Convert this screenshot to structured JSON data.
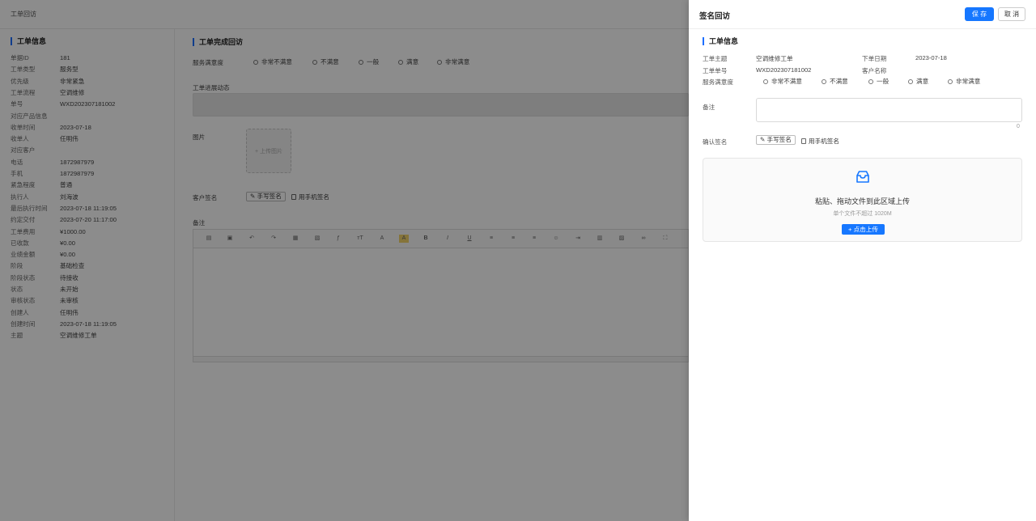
{
  "background": {
    "header_title": "工单回访",
    "left": {
      "section_title": "工单信息",
      "fields": [
        {
          "label": "单据ID",
          "value": "181"
        },
        {
          "label": "工单类型",
          "value": "服务型"
        },
        {
          "label": "优先级",
          "value": "非常紧急"
        },
        {
          "label": "工单流程",
          "value": "空调维修"
        },
        {
          "label": "单号",
          "value": "WXD202307181002"
        },
        {
          "label": "对应产品信息",
          "value": ""
        },
        {
          "label": "收单时间",
          "value": "2023-07-18"
        },
        {
          "label": "收单人",
          "value": "任明伟"
        },
        {
          "label": "对应客户",
          "value": ""
        },
        {
          "label": "电话",
          "value": "1872987979"
        },
        {
          "label": "手机",
          "value": "1872987979"
        },
        {
          "label": "紧急程度",
          "value": "普通"
        },
        {
          "label": "执行人",
          "value": "刘海波"
        },
        {
          "label": "最后执行时间",
          "value": "2023-07-18 11:19:05"
        },
        {
          "label": "约定交付",
          "value": "2023-07-20 11:17:00"
        },
        {
          "label": "工单费用",
          "value": "¥1000.00"
        },
        {
          "label": "已收款",
          "value": "¥0.00"
        },
        {
          "label": "业绩金额",
          "value": "¥0.00"
        },
        {
          "label": "阶段",
          "value": "基础检查"
        },
        {
          "label": "阶段状态",
          "value": "待接收"
        },
        {
          "label": "状态",
          "value": "未开始"
        },
        {
          "label": "审核状态",
          "value": "未审核"
        },
        {
          "label": "创建人",
          "value": "任明伟"
        },
        {
          "label": "创建时间",
          "value": "2023-07-18 11:19:05"
        },
        {
          "label": "主题",
          "value": "空调维修工单"
        }
      ]
    },
    "main": {
      "section_title": "工单完成回访",
      "satisfaction_label": "服务满意度",
      "satisfaction_options": [
        "非常不满意",
        "不满意",
        "一般",
        "满意",
        "非常满意"
      ],
      "progress_label": "工单进展动态",
      "image_label": "图片",
      "upload_image_text": "+ 上传图片",
      "customer_sign_label": "客户签名",
      "handwrite_btn": "手写签名",
      "phone_sign": "用手机签名",
      "remark_label": "备注"
    }
  },
  "drawer": {
    "title": "签名回访",
    "save_label": "保 存",
    "cancel_label": "取 消",
    "section_title": "工单信息",
    "subject_label": "工单主题",
    "subject_value": "空调维修工单",
    "order_date_label": "下单日期",
    "order_date_value": "2023-07-18",
    "number_label": "工单单号",
    "number_value": "WXD202307181002",
    "customer_label": "客户名称",
    "customer_value": "",
    "satisfaction_label": "服务满意度",
    "satisfaction_options": [
      "非常不满意",
      "不满意",
      "一般",
      "满意",
      "非常满意"
    ],
    "remark_label": "备注",
    "remark_count": "0",
    "confirm_sign_label": "确认签名",
    "handwrite_btn": "手写签名",
    "phone_sign": "用手机签名",
    "drop_title": "粘贴、拖动文件到此区域上传",
    "drop_sub": "单个文件不超过 1020M",
    "upload_btn": "+ 点击上传"
  },
  "colors": {
    "accent": "#1677ff",
    "overlay": "rgba(0,0,0,0.45)"
  }
}
